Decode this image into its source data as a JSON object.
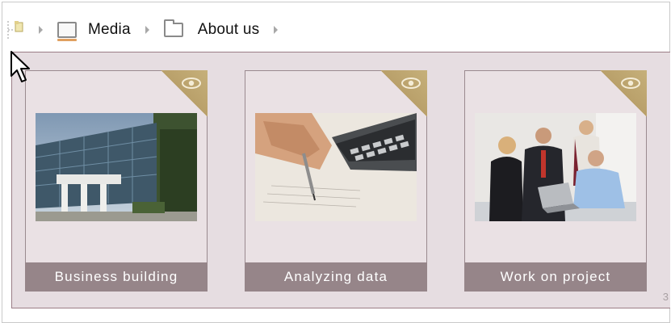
{
  "breadcrumb": {
    "items": [
      {
        "label": "Media",
        "icon": "monitor-icon"
      },
      {
        "label": "About us",
        "icon": "folder-icon"
      }
    ]
  },
  "gallery": {
    "cards": [
      {
        "caption": "Business building",
        "image": "office-building-photo"
      },
      {
        "caption": "Analyzing data",
        "image": "calculator-and-pen-photo"
      },
      {
        "caption": "Work on project",
        "image": "business-team-meeting-photo"
      }
    ],
    "page_number": "3"
  },
  "colors": {
    "gallery_bg": "#e6dde1",
    "card_bg": "#eae1e4",
    "caption_bg": "#968589",
    "corner_gold": "#c6b07a"
  }
}
